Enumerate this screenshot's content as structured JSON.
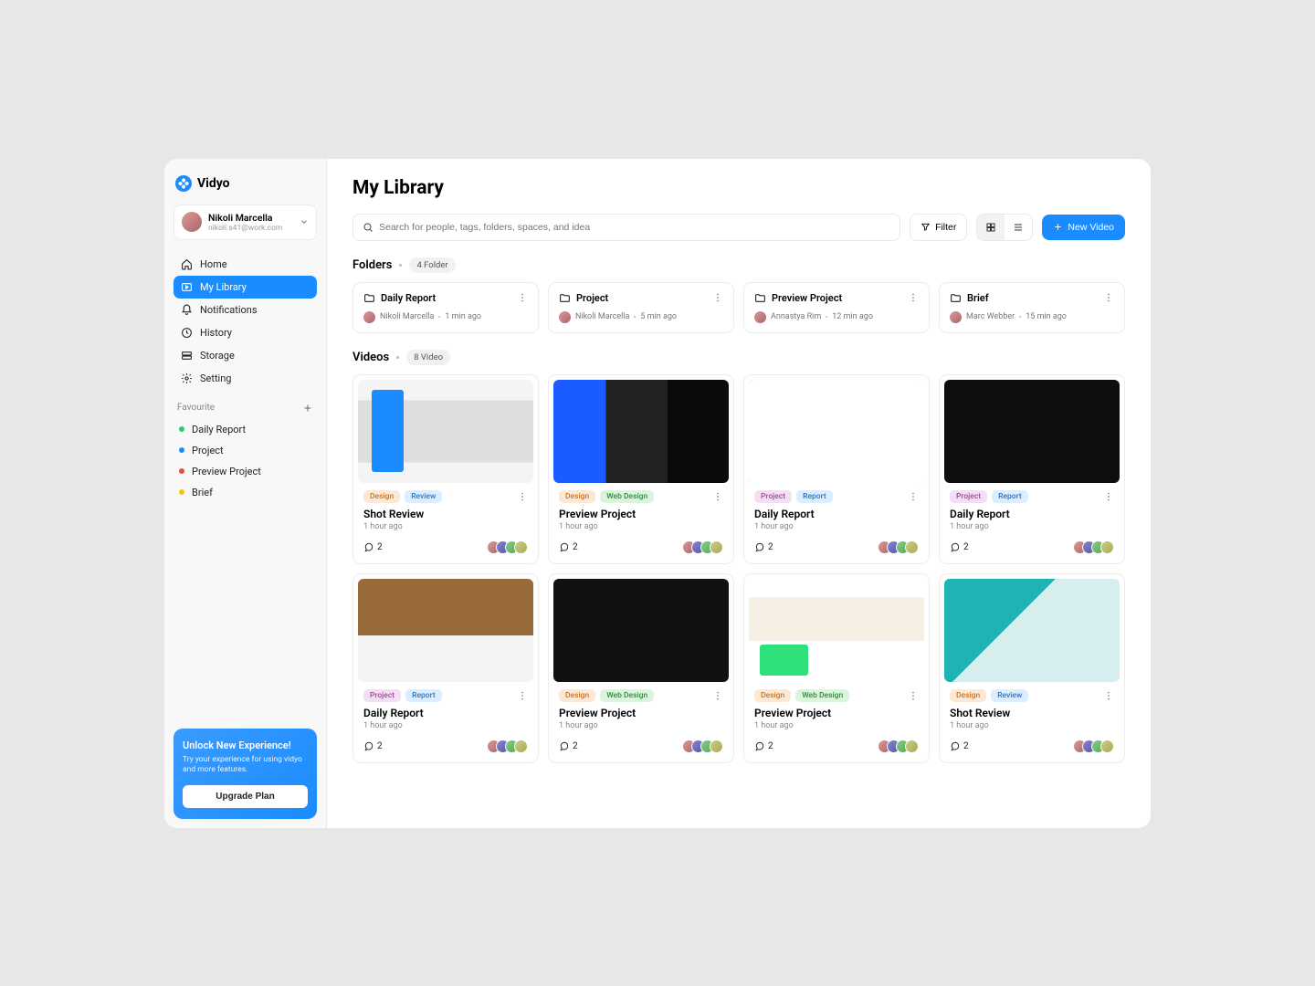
{
  "brand": "Vidyo",
  "user": {
    "name": "Nikoli Marcella",
    "email": "nikoli.s41@work.com"
  },
  "nav": {
    "home": "Home",
    "library": "My Library",
    "notifications": "Notifications",
    "history": "History",
    "storage": "Storage",
    "setting": "Setting"
  },
  "favourite_label": "Favourite",
  "favourites": [
    {
      "label": "Daily Report",
      "color": "#2ecc71"
    },
    {
      "label": "Project",
      "color": "#1a8cff"
    },
    {
      "label": "Preview Project",
      "color": "#e74c3c"
    },
    {
      "label": "Brief",
      "color": "#f1c40f"
    }
  ],
  "upgrade": {
    "title": "Unlock New Experience!",
    "subtitle": "Try your experience for using vidyo and more features.",
    "cta": "Upgrade Plan"
  },
  "page_title": "My Library",
  "search_placeholder": "Search for people, tags, folders, spaces, and idea",
  "filter_label": "Filter",
  "new_video_label": "New Video",
  "folders_title": "Folders",
  "folders_badge": "4 Folder",
  "folders": [
    {
      "name": "Daily Report",
      "owner": "Nikoli Marcella",
      "time": "1 min ago"
    },
    {
      "name": "Project",
      "owner": "Nikoli Marcella",
      "time": "5 min ago"
    },
    {
      "name": "Preview Project",
      "owner": "Annastya Rim",
      "time": "12 min ago"
    },
    {
      "name": "Brief",
      "owner": "Marc Webber",
      "time": "15 min ago"
    }
  ],
  "videos_title": "Videos",
  "videos_badge": "8 Video",
  "videos": [
    {
      "tags": [
        [
          "design",
          "Design"
        ],
        [
          "review",
          "Review"
        ]
      ],
      "title": "Shot Review",
      "time": "1 hour ago",
      "comments": "2"
    },
    {
      "tags": [
        [
          "design",
          "Design"
        ],
        [
          "web",
          "Web Design"
        ]
      ],
      "title": "Preview Project",
      "time": "1 hour ago",
      "comments": "2"
    },
    {
      "tags": [
        [
          "project",
          "Project"
        ],
        [
          "report",
          "Report"
        ]
      ],
      "title": "Daily Report",
      "time": "1 hour ago",
      "comments": "2"
    },
    {
      "tags": [
        [
          "project",
          "Project"
        ],
        [
          "report",
          "Report"
        ]
      ],
      "title": "Daily Report",
      "time": "1 hour ago",
      "comments": "2"
    },
    {
      "tags": [
        [
          "project",
          "Project"
        ],
        [
          "report",
          "Report"
        ]
      ],
      "title": "Daily Report",
      "time": "1 hour ago",
      "comments": "2"
    },
    {
      "tags": [
        [
          "design",
          "Design"
        ],
        [
          "web",
          "Web Design"
        ]
      ],
      "title": "Preview Project",
      "time": "1 hour ago",
      "comments": "2"
    },
    {
      "tags": [
        [
          "design",
          "Design"
        ],
        [
          "web",
          "Web Design"
        ]
      ],
      "title": "Preview Project",
      "time": "1 hour ago",
      "comments": "2"
    },
    {
      "tags": [
        [
          "design",
          "Design"
        ],
        [
          "review",
          "Review"
        ]
      ],
      "title": "Shot Review",
      "time": "1 hour ago",
      "comments": "2"
    }
  ]
}
